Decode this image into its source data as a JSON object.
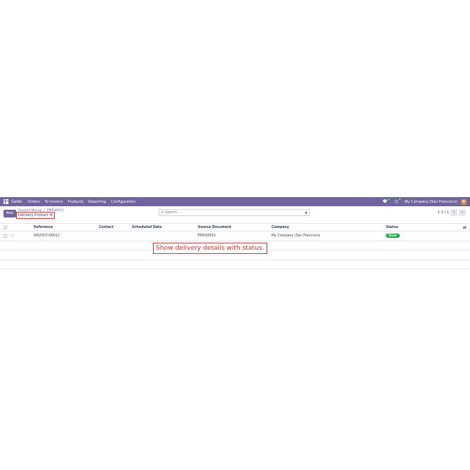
{
  "topbar": {
    "app_name": "Sales",
    "menu": [
      "Orders",
      "To Invoice",
      "Products",
      "Reporting",
      "Configuration"
    ],
    "chat_badge": "4",
    "activity_badge": "6",
    "company": "My Company (San Francisco)"
  },
  "control": {
    "new_label": "New",
    "breadcrumb": [
      "Product Mixing",
      "PMX00001"
    ],
    "current": "Delivery Product",
    "search_placeholder": "Search...",
    "pager": "1-1 / 1"
  },
  "table": {
    "headers": {
      "reference": "Reference",
      "contact": "Contact",
      "scheduled_date": "Scheduled Date",
      "source_document": "Source Document",
      "company": "Company",
      "status": "Status"
    },
    "rows": [
      {
        "reference": "WH/OUT/00012",
        "contact": "",
        "scheduled_date": "",
        "source_document": "PMX00001",
        "company": "My Company (San Francisco)",
        "status": "Done"
      }
    ]
  },
  "annotation": "Show delivery details with status.",
  "colors": {
    "brand": "#71639e",
    "status_done": "#28a745",
    "annotation": "#d32f2f"
  },
  "icons": [
    "apps-grid-icon",
    "chat-icon",
    "activity-clock-icon",
    "avatar",
    "gear-icon",
    "search-icon",
    "caret-down-icon",
    "chevron-left-icon",
    "chevron-right-icon",
    "star-icon",
    "optional-columns-icon"
  ]
}
